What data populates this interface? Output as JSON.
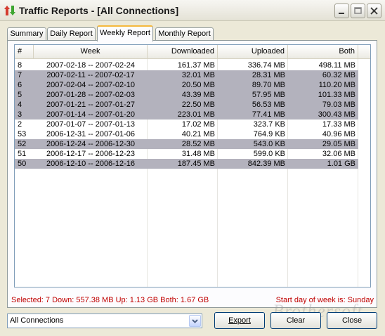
{
  "window": {
    "title": "Traffic Reports - [All Connections]"
  },
  "tabs": [
    {
      "label": "Summary"
    },
    {
      "label": "Daily Report"
    },
    {
      "label": "Weekly Report"
    },
    {
      "label": "Monthly Report"
    }
  ],
  "table": {
    "columns": [
      "#",
      "Week",
      "Downloaded",
      "Uploaded",
      "Both"
    ],
    "rows": [
      {
        "num": "8",
        "week": "2007-02-18 -- 2007-02-24",
        "down": "161.37 MB",
        "up": "336.74 MB",
        "both": "498.11 MB",
        "selected": false
      },
      {
        "num": "7",
        "week": "2007-02-11 -- 2007-02-17",
        "down": "32.01 MB",
        "up": "28.31 MB",
        "both": "60.32 MB",
        "selected": true
      },
      {
        "num": "6",
        "week": "2007-02-04 -- 2007-02-10",
        "down": "20.50 MB",
        "up": "89.70 MB",
        "both": "110.20 MB",
        "selected": true
      },
      {
        "num": "5",
        "week": "2007-01-28 -- 2007-02-03",
        "down": "43.39 MB",
        "up": "57.95 MB",
        "both": "101.33 MB",
        "selected": true
      },
      {
        "num": "4",
        "week": "2007-01-21 -- 2007-01-27",
        "down": "22.50 MB",
        "up": "56.53 MB",
        "both": "79.03 MB",
        "selected": true
      },
      {
        "num": "3",
        "week": "2007-01-14 -- 2007-01-20",
        "down": "223.01 MB",
        "up": "77.41 MB",
        "both": "300.43 MB",
        "selected": true
      },
      {
        "num": "2",
        "week": "2007-01-07 -- 2007-01-13",
        "down": "17.02 MB",
        "up": "323.7 KB",
        "both": "17.33 MB",
        "selected": false
      },
      {
        "num": "53",
        "week": "2006-12-31 -- 2007-01-06",
        "down": "40.21 MB",
        "up": "764.9 KB",
        "both": "40.96 MB",
        "selected": false
      },
      {
        "num": "52",
        "week": "2006-12-24 -- 2006-12-30",
        "down": "28.52 MB",
        "up": "543.0 KB",
        "both": "29.05 MB",
        "selected": true
      },
      {
        "num": "51",
        "week": "2006-12-17 -- 2006-12-23",
        "down": "31.48 MB",
        "up": "599.0 KB",
        "both": "32.06 MB",
        "selected": false
      },
      {
        "num": "50",
        "week": "2006-12-10 -- 2006-12-16",
        "down": "187.45 MB",
        "up": "842.39 MB",
        "both": "1.01 GB",
        "selected": true
      }
    ]
  },
  "status": {
    "summary": "Selected: 7   Down: 557.38 MB   Up: 1.13 GB   Both: 1.67 GB",
    "week_start": "Start day of week is: Sunday"
  },
  "connection_select": {
    "value": "All Connections"
  },
  "buttons": {
    "export": "Export",
    "clear": "Clear",
    "close": "Close"
  },
  "watermark": "Brothersoft",
  "colors": {
    "status_text": "#c00000",
    "selected_row": "#b3b2bd",
    "active_tab_accent": "#f5b83d"
  },
  "icons": {
    "app": "traffic-arrows-icon",
    "minimize": "minimize-icon",
    "maximize": "maximize-icon",
    "close": "close-icon",
    "dropdown": "chevron-down-icon"
  }
}
